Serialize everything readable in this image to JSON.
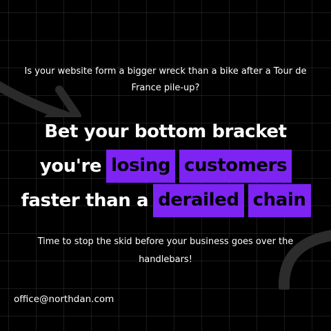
{
  "intro_text": "Is your website form a bigger wreck than a bike after a Tour de France pile-up?",
  "headline": {
    "line1": "Bet your bottom bracket",
    "line2_prefix": "you're",
    "line2_highlights": [
      "losing",
      "customers"
    ],
    "line3_prefix": "faster than a",
    "line3_highlights": [
      "derailed",
      "chain"
    ]
  },
  "outro_text": "Time to stop the skid before your business goes over the handlebars!",
  "contact_email": "office@northdan.com",
  "colors": {
    "background": "#000000",
    "highlight": "#7d24f2",
    "text": "#ffffff",
    "grid": "rgba(255,255,255,0.10)"
  },
  "icons": [
    "curved-arrow-icon",
    "arc-decoration-icon"
  ]
}
